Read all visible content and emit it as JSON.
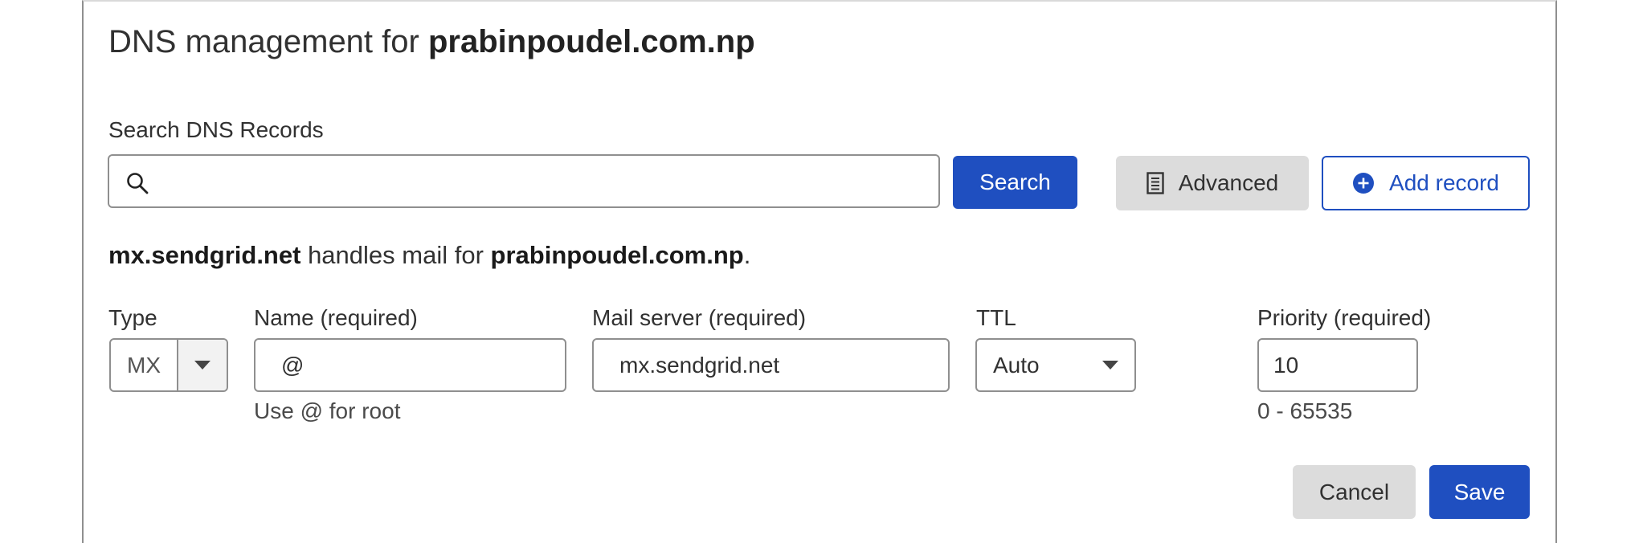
{
  "header": {
    "title_prefix": "DNS management for",
    "domain": "prabinpoudel.com.np"
  },
  "search": {
    "label": "Search DNS Records",
    "value": "",
    "placeholder": "",
    "button_label": "Search"
  },
  "toolbar": {
    "advanced_label": "Advanced",
    "add_record_label": "Add record"
  },
  "mail_info": {
    "server": "mx.sendgrid.net",
    "middle": "handles mail for",
    "domain": "prabinpoudel.com.np",
    "end": "."
  },
  "record_form": {
    "type": {
      "label": "Type",
      "value": "MX"
    },
    "name": {
      "label": "Name (required)",
      "value": "@",
      "hint": "Use @ for root"
    },
    "mail_server": {
      "label": "Mail server (required)",
      "value": "mx.sendgrid.net"
    },
    "ttl": {
      "label": "TTL",
      "value": "Auto"
    },
    "priority": {
      "label": "Priority (required)",
      "value": "10",
      "hint": "0 - 65535"
    }
  },
  "actions": {
    "cancel_label": "Cancel",
    "save_label": "Save"
  },
  "icons": {
    "search": "search-icon",
    "advanced": "document-list-icon",
    "add": "plus-circle-icon",
    "dropdown": "chevron-down-icon"
  },
  "colors": {
    "primary": "#1f4fc0",
    "secondary_bg": "#dcdcdc",
    "border": "#8f8f8f",
    "text": "#313131"
  }
}
